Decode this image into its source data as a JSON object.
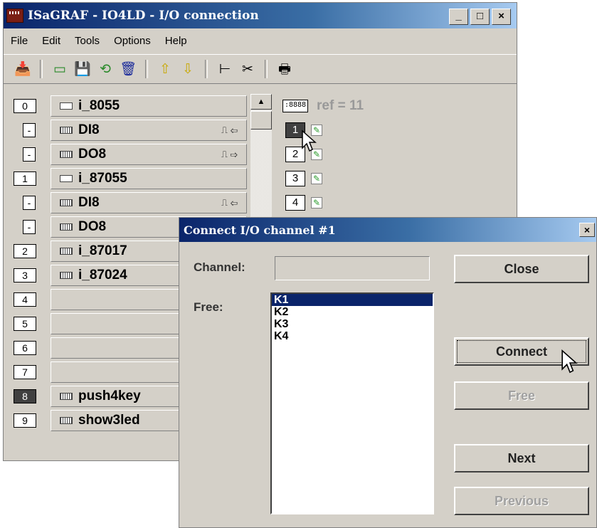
{
  "window": {
    "title": "ISaGRAF - IO4LD - I/O connection",
    "controls": [
      "_",
      "□",
      "×"
    ]
  },
  "menu": [
    "File",
    "Edit",
    "Tools",
    "Options",
    "Help"
  ],
  "toolbar": [
    "📥",
    "▭",
    "💾",
    "⟲",
    "🗑",
    "⇧",
    "⇩",
    "⊢",
    "✂",
    "🖶"
  ],
  "slots": [
    {
      "index": "0",
      "name": "i_8055",
      "sub": false,
      "card": true,
      "signal": ""
    },
    {
      "index": "-",
      "name": "DI8",
      "sub": true,
      "card": false,
      "signal": "⎍ ⇦"
    },
    {
      "index": "-",
      "name": "DO8",
      "sub": true,
      "card": false,
      "signal": "⎍ ⇨"
    },
    {
      "index": "1",
      "name": "i_87055",
      "sub": false,
      "card": true,
      "signal": ""
    },
    {
      "index": "-",
      "name": "DI8",
      "sub": true,
      "card": false,
      "signal": "⎍ ⇦"
    },
    {
      "index": "-",
      "name": "DO8",
      "sub": true,
      "card": false,
      "signal": ""
    },
    {
      "index": "2",
      "name": "i_87017",
      "sub": false,
      "card": false,
      "signal": ""
    },
    {
      "index": "3",
      "name": "i_87024",
      "sub": false,
      "card": false,
      "signal": ""
    },
    {
      "index": "4",
      "name": "",
      "sub": false,
      "card": false,
      "signal": ""
    },
    {
      "index": "5",
      "name": "",
      "sub": false,
      "card": false,
      "signal": ""
    },
    {
      "index": "6",
      "name": "",
      "sub": false,
      "card": false,
      "signal": ""
    },
    {
      "index": "7",
      "name": "",
      "sub": false,
      "card": false,
      "signal": ""
    },
    {
      "index": "8",
      "name": "push4key",
      "sub": false,
      "card": false,
      "signal": "",
      "selected": true
    },
    {
      "index": "9",
      "name": "show3led",
      "sub": false,
      "card": false,
      "signal": ""
    }
  ],
  "channels": {
    "board_icon": ":8888",
    "ref": "ref = 11",
    "items": [
      "1",
      "2",
      "3",
      "4"
    ]
  },
  "dialog": {
    "title": "Connect I/O channel #1",
    "channel_label": "Channel:",
    "channel_value": "",
    "free_label": "Free:",
    "free_items": [
      "K1",
      "K2",
      "K3",
      "K4"
    ],
    "buttons": {
      "close": "Close",
      "connect": "Connect",
      "free": "Free",
      "next": "Next",
      "previous": "Previous"
    }
  }
}
